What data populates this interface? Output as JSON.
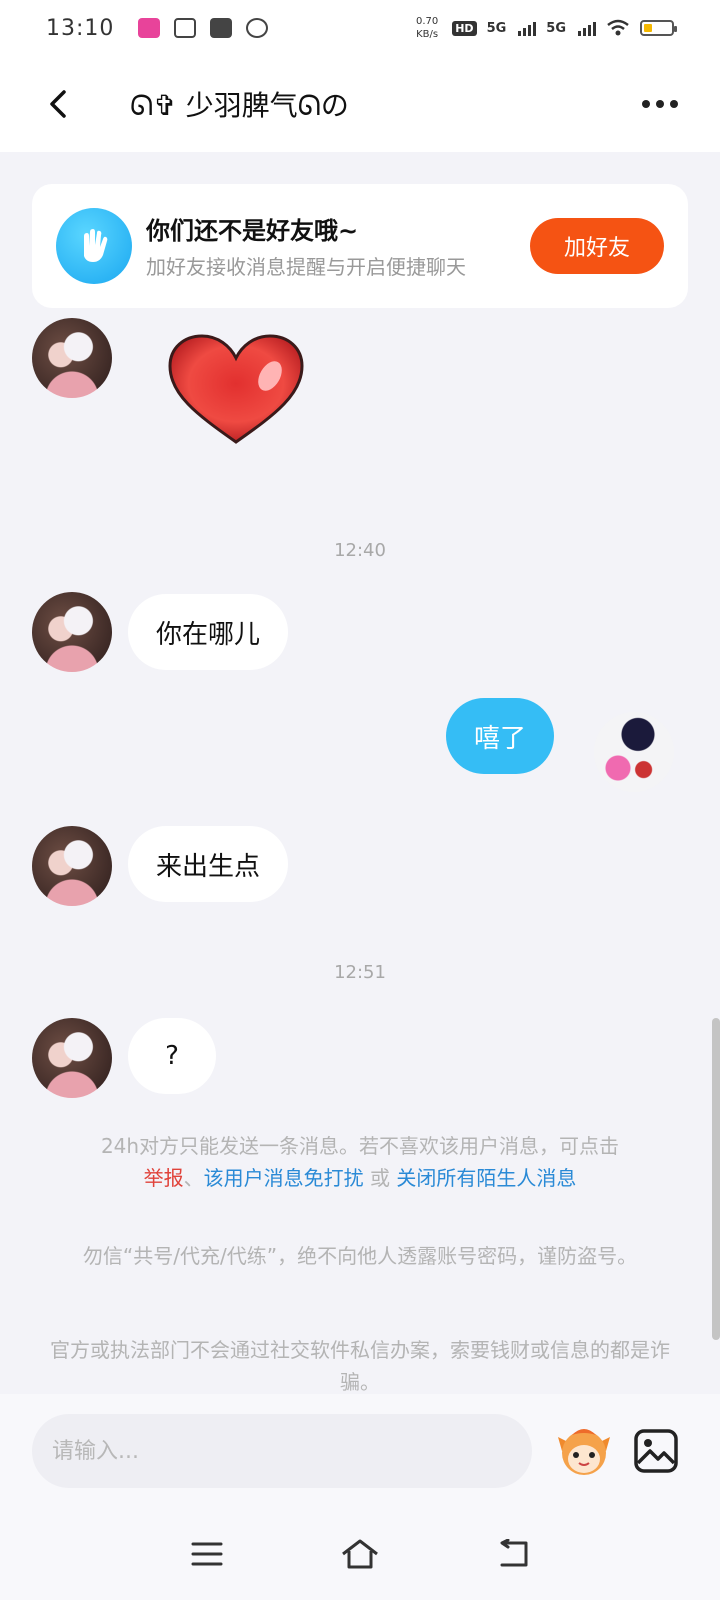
{
  "status": {
    "time": "13:10",
    "speed_top": "0.70",
    "speed_bottom": "KB/s",
    "hd": "HD",
    "net1": "5G",
    "net2": "5G"
  },
  "header": {
    "title": "ᘏ✞ 少羽脾气ᘏの"
  },
  "friend_banner": {
    "title": "你们还不是好友哦~",
    "subtitle": "加好友接收消息提醒与开启便捷聊天",
    "button": "加好友"
  },
  "messages": {
    "time1": "12:40",
    "msg1": "你在哪儿",
    "msg2": "嘻了",
    "msg3": "来出生点",
    "time2": "12:51",
    "msg4": "?"
  },
  "notices": {
    "line1": "24h对方只能发送一条消息。若不喜欢该用户消息，可点击",
    "report": "举报",
    "sep": "、",
    "mute": "该用户消息免打扰",
    "or": " 或 ",
    "close_all": "关闭所有陌生人消息",
    "warn1": "勿信“共号/代充/代练”，绝不向他人透露账号密码，谨防盗号。",
    "warn2": "官方或执法部门不会通过社交软件私信办案，索要钱财或信息的都是诈骗。"
  },
  "input": {
    "placeholder": "请输入..."
  },
  "colors": {
    "accent_blue": "#35bdf5",
    "add_button": "#f55313",
    "report_red": "#e0423a",
    "link_blue": "#2a8ad6"
  }
}
